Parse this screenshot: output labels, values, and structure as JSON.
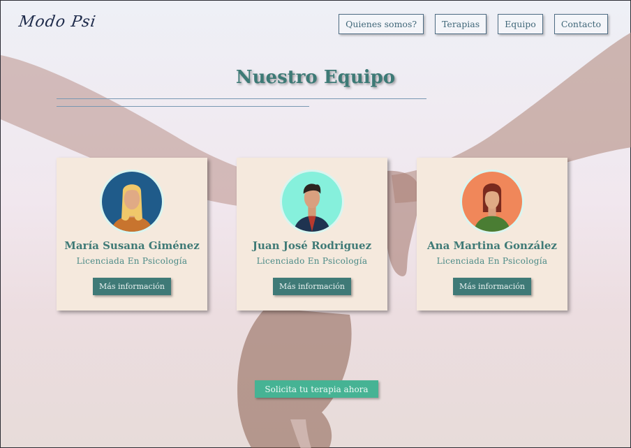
{
  "brand": {
    "logo": "Modo Psi"
  },
  "nav": [
    {
      "label": "Quienes somos?"
    },
    {
      "label": "Terapias"
    },
    {
      "label": "Equipo"
    },
    {
      "label": "Contacto"
    }
  ],
  "section": {
    "title": "Nuestro Equipo"
  },
  "team": [
    {
      "name": "María Susana Giménez",
      "role": "Licenciada En Psicología",
      "button": "Más información",
      "avatar_bg": "#1f5b8a",
      "avatar": "woman-blonde-icon"
    },
    {
      "name": "Juan José Rodriguez",
      "role": "Licenciado En Psicología",
      "button": "Más información",
      "avatar_bg": "#86f0dc",
      "avatar": "man-suit-icon"
    },
    {
      "name": "Ana Martina González",
      "role": "Licenciada En Psicología",
      "button": "Más información",
      "avatar_bg": "#f0875a",
      "avatar": "woman-brunette-icon"
    }
  ],
  "cta": {
    "label": "Solicita tu terapia ahora"
  },
  "colors": {
    "accent": "#3f7a77",
    "cta": "#46b394",
    "card": "#f5e9dd"
  }
}
